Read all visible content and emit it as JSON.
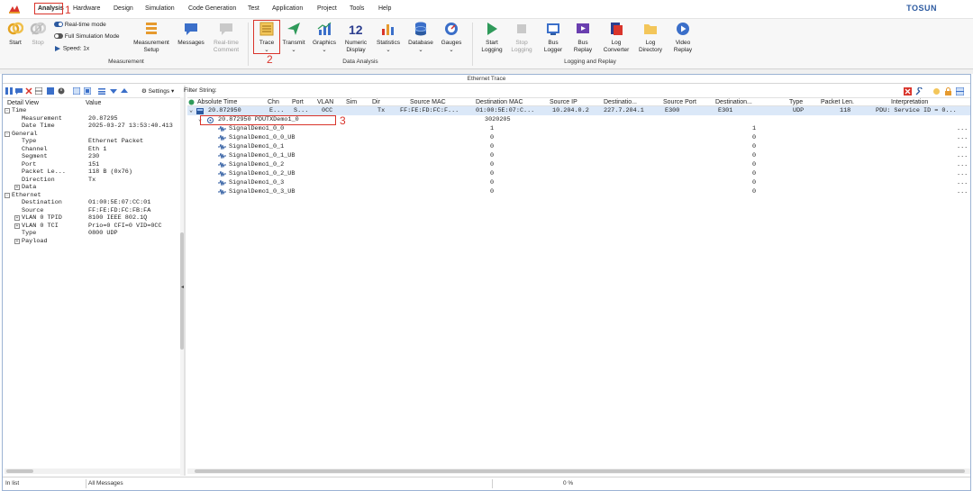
{
  "menu": {
    "items": [
      "Analysis",
      "Hardware",
      "Design",
      "Simulation",
      "Code Generation",
      "Test",
      "Application",
      "Project",
      "Tools",
      "Help"
    ],
    "brand": "TOSUN"
  },
  "annotations": [
    "1",
    "2",
    "3"
  ],
  "ribbon": {
    "start": "Start",
    "stop": "Stop",
    "realtime_mode": "Real-time mode",
    "full_sim_mode": "Full Simulation Mode",
    "speed": "Speed: 1x",
    "measurement_setup": [
      "Measurement",
      "Setup"
    ],
    "messages": "Messages",
    "realtime_comment": [
      "Real-time",
      "Comment"
    ],
    "measurement_group": "Measurement",
    "trace": "Trace",
    "transmit": "Transmit",
    "graphics": "Graphics",
    "numeric_display": [
      "Numeric",
      "Display"
    ],
    "statistics": "Statistics",
    "database": "Database",
    "gauges": "Gauges",
    "data_analysis_group": "Data Analysis",
    "start_logging": [
      "Start",
      "Logging"
    ],
    "stop_logging": [
      "Stop",
      "Logging"
    ],
    "bus_logger": [
      "Bus",
      "Logger"
    ],
    "bus_replay": [
      "Bus",
      "Replay"
    ],
    "log_converter": [
      "Log",
      "Converter"
    ],
    "log_directory": [
      "Log",
      "Directory"
    ],
    "video_replay": [
      "Video",
      "Replay"
    ],
    "logging_group": "Logging and Replay"
  },
  "window": {
    "title": "Ethernet Trace"
  },
  "left_pane": {
    "settings_label": "Settings",
    "header_detail": "Detail View",
    "header_value": "Value",
    "rows": [
      {
        "label": "Time",
        "value": "",
        "level": 0,
        "expander": "-"
      },
      {
        "label": "Measurement",
        "value": "20.87295",
        "level": 1,
        "expander": ""
      },
      {
        "label": "Date Time",
        "value": "2025-03-27 13:53:40.413",
        "level": 1,
        "expander": ""
      },
      {
        "label": "General",
        "value": "",
        "level": 0,
        "expander": "-"
      },
      {
        "label": "Type",
        "value": "Ethernet Packet",
        "level": 1,
        "expander": ""
      },
      {
        "label": "Channel",
        "value": "Eth 1",
        "level": 1,
        "expander": ""
      },
      {
        "label": "Segment",
        "value": "230",
        "level": 1,
        "expander": ""
      },
      {
        "label": "Port",
        "value": "151",
        "level": 1,
        "expander": ""
      },
      {
        "label": "Packet Le...",
        "value": "118 B (0x76)",
        "level": 1,
        "expander": ""
      },
      {
        "label": "Direction",
        "value": "Tx",
        "level": 1,
        "expander": ""
      },
      {
        "label": "Data",
        "value": "",
        "level": 1,
        "expander": "+"
      },
      {
        "label": "Ethernet",
        "value": "",
        "level": 0,
        "expander": "-"
      },
      {
        "label": "Destination",
        "value": "01:00:5E:07:CC:01",
        "level": 1,
        "expander": ""
      },
      {
        "label": "Source",
        "value": "FF:FE:FD:FC:FB:FA",
        "level": 1,
        "expander": ""
      },
      {
        "label": "VLAN 0 TPID",
        "value": "8100 IEEE 802.1Q",
        "level": 1,
        "expander": "+"
      },
      {
        "label": "VLAN 0 TCI",
        "value": "Prio=0 CFI=0 VID=0CC",
        "level": 1,
        "expander": "+"
      },
      {
        "label": "Type",
        "value": "0800 UDP",
        "level": 1,
        "expander": ""
      },
      {
        "label": "Payload",
        "value": "",
        "level": 1,
        "expander": "+"
      }
    ]
  },
  "filter": {
    "label": "Filter String:",
    "value": ""
  },
  "trace": {
    "columns": [
      "Absolute Time",
      "Chn",
      "Port",
      "VLAN",
      "Sim",
      "Dir",
      "Source MAC",
      "Destination MAC",
      "Source IP",
      "Destinatio...",
      "Source Port",
      "Destination...",
      "Type",
      "Packet Len.",
      "Interpretation"
    ],
    "packet_row": {
      "time": "20.872950",
      "chn": "E...",
      "port": "S...",
      "vlan": "0CC",
      "sim": "",
      "dir": "Tx",
      "src_mac": "FF:FE:FD:FC:F...",
      "dst_mac": "01:00:5E:07:C...",
      "src_ip": "10.204.0.2",
      "dst_ip": "227.7.204.1",
      "src_port": "E300",
      "dst_port": "E301",
      "type": "UDP",
      "len": "118",
      "interp": "PDU: Service ID = 0..."
    },
    "pdu_row": {
      "label": "20.872950  PDUTXDemo1_0",
      "dst_mac": "3020205"
    },
    "signals": [
      {
        "name": "SignalDemo1_0_0",
        "raw": "1",
        "phys": "1"
      },
      {
        "name": "SignalDemo1_0_0_UB",
        "raw": "0",
        "phys": "0"
      },
      {
        "name": "SignalDemo1_0_1",
        "raw": "0",
        "phys": "0"
      },
      {
        "name": "SignalDemo1_0_1_UB",
        "raw": "0",
        "phys": "0"
      },
      {
        "name": "SignalDemo1_0_2",
        "raw": "0",
        "phys": "0"
      },
      {
        "name": "SignalDemo1_0_2_UB",
        "raw": "0",
        "phys": "0"
      },
      {
        "name": "SignalDemo1_0_3",
        "raw": "0",
        "phys": "0"
      },
      {
        "name": "SignalDemo1_0_3_UB",
        "raw": "0",
        "phys": "0"
      }
    ],
    "ellipsis": "..."
  },
  "status": {
    "left": "In list",
    "messages": "All Messages",
    "progress": "0 %"
  },
  "colors": {
    "accent": "#2c5aa0",
    "annotation": "#d9342b",
    "selection": "#dbe8f8"
  }
}
